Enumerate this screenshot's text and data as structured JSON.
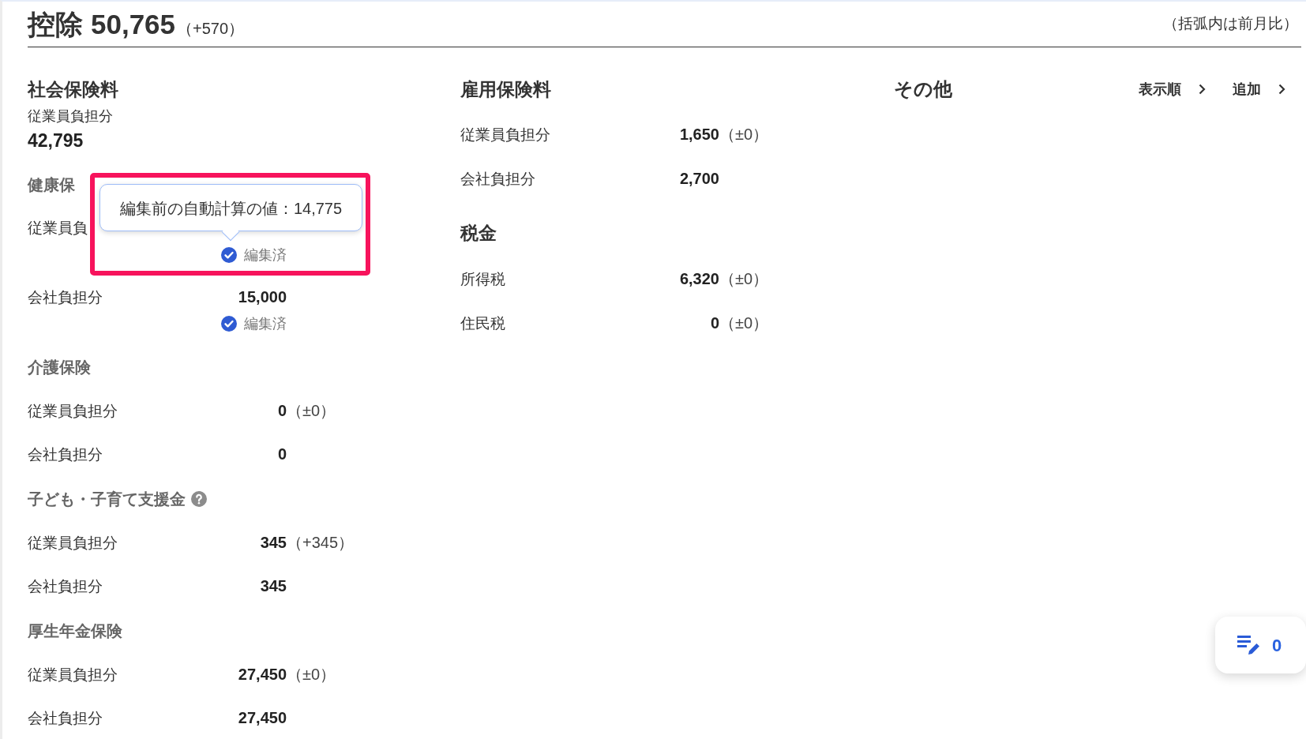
{
  "header": {
    "title": "控除",
    "total": "50,765",
    "change": "（+570）",
    "note": "（括弧内は前月比）"
  },
  "social_insurance": {
    "title": "社会保険料",
    "summary_label": "従業員負担分",
    "summary_value": "42,795",
    "groups": [
      {
        "title": "健康保",
        "help": false,
        "rows": [
          {
            "label": "従業員負",
            "edited_note": "編集済",
            "tooltip": {
              "text": "編集前の自動計算の値：14,775",
              "highlighted": true
            }
          },
          {
            "label": "会社負担分",
            "value": "15,000",
            "edited_note": "編集済"
          }
        ]
      },
      {
        "title": "介護保険",
        "help": false,
        "rows": [
          {
            "label": "従業員負担分",
            "value": "0",
            "change": "（±0）"
          },
          {
            "label": "会社負担分",
            "value": "0"
          }
        ]
      },
      {
        "title": "子ども・子育て支援金",
        "help": true,
        "rows": [
          {
            "label": "従業員負担分",
            "value": "345",
            "change": "（+345）"
          },
          {
            "label": "会社負担分",
            "value": "345"
          }
        ]
      },
      {
        "title": "厚生年金保険",
        "help": false,
        "rows": [
          {
            "label": "従業員負担分",
            "value": "27,450",
            "change": "（±0）"
          },
          {
            "label": "会社負担分",
            "value": "27,450"
          }
        ]
      }
    ]
  },
  "employment_insurance": {
    "title": "雇用保険料",
    "rows": [
      {
        "label": "従業員負担分",
        "value": "1,650",
        "change": "（±0）"
      },
      {
        "label": "会社負担分",
        "value": "2,700"
      }
    ]
  },
  "taxes": {
    "title": "税金",
    "rows": [
      {
        "label": "所得税",
        "value": "6,320",
        "change": "（±0）"
      },
      {
        "label": "住民税",
        "value": "0",
        "change": "（±0）"
      }
    ]
  },
  "other": {
    "title": "その他",
    "links": [
      "表示順",
      "追加"
    ]
  },
  "edit_list_button": {
    "count": "0"
  }
}
